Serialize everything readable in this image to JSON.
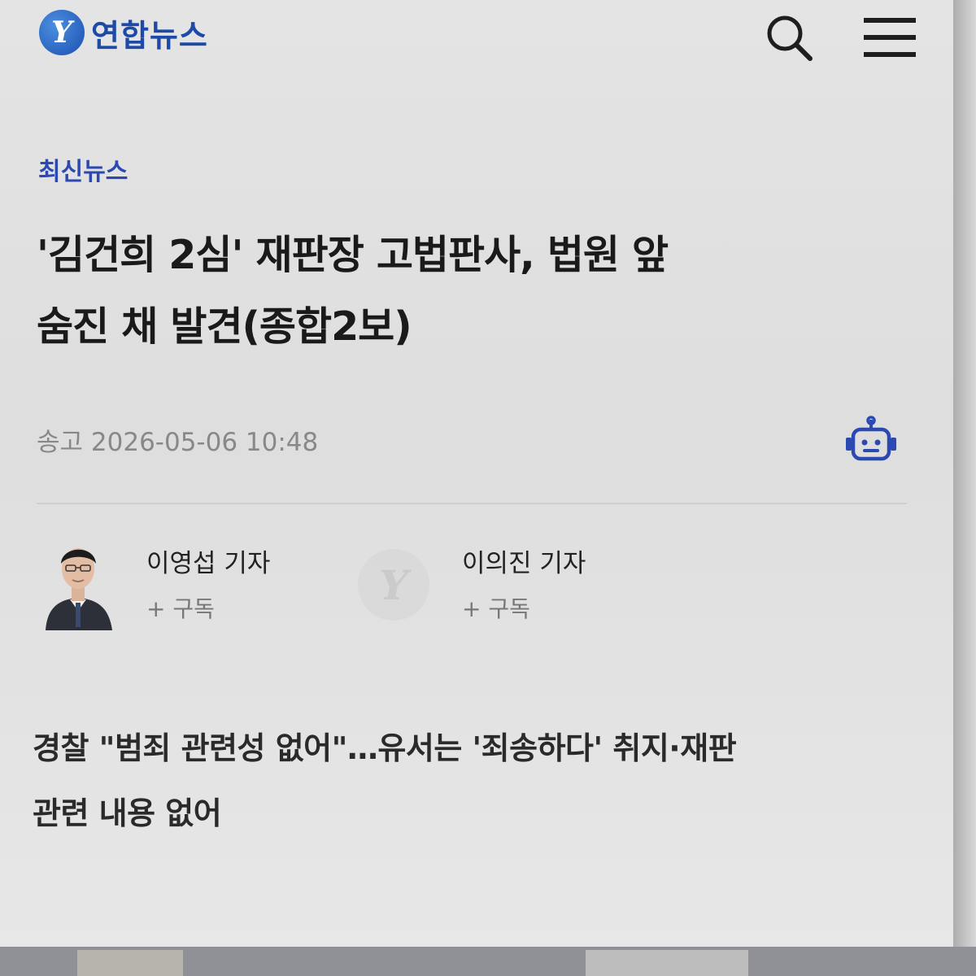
{
  "header": {
    "logo_text": "연합뉴스",
    "logo_mark": "Y",
    "search_icon": "search-icon",
    "menu_icon": "hamburger-menu-icon",
    "brand_color": "#1d4aa6"
  },
  "article": {
    "category": "최신뉴스",
    "headline_line1": "'김건희 2심' 재판장 고법판사, 법원 앞",
    "headline_line2": "숨진 채 발견(종합2보)",
    "timestamp_label": "송고",
    "timestamp_value": "2026-05-06 10:48",
    "ai_icon": "robot-icon",
    "subhead_line1": "경찰 \"범죄 관련성 없어\"…유서는 '죄송하다' 취지·재판",
    "subhead_line2": "관련 내용 없어"
  },
  "reporters": [
    {
      "name": "이영섭 기자",
      "subscribe": "+ 구독",
      "has_photo": true
    },
    {
      "name": "이의진 기자",
      "subscribe": "+ 구독",
      "has_photo": false
    }
  ]
}
